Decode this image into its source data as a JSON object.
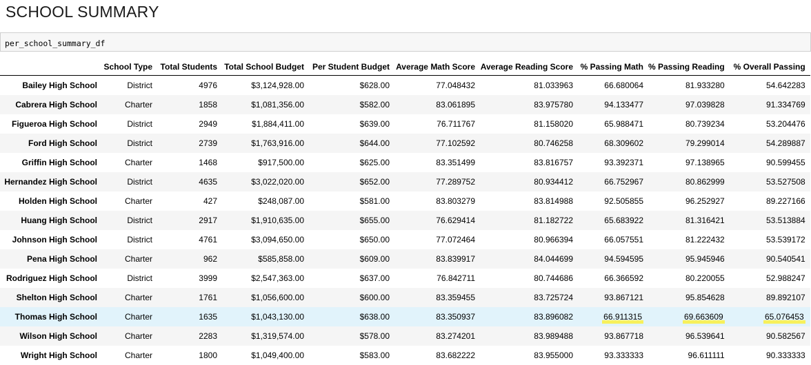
{
  "page": {
    "title": "SCHOOL SUMMARY",
    "code": "per_school_summary_df"
  },
  "table": {
    "columns": [
      "",
      "School Type",
      "Total Students",
      "Total School Budget",
      "Per Student Budget",
      "Average Math Score",
      "Average Reading Score",
      "% Passing Math",
      "% Passing Reading",
      "% Overall Passing"
    ],
    "rows": [
      [
        "Bailey High School",
        "District",
        "4976",
        "$3,124,928.00",
        "$628.00",
        "77.048432",
        "81.033963",
        "66.680064",
        "81.933280",
        "54.642283"
      ],
      [
        "Cabrera High School",
        "Charter",
        "1858",
        "$1,081,356.00",
        "$582.00",
        "83.061895",
        "83.975780",
        "94.133477",
        "97.039828",
        "91.334769"
      ],
      [
        "Figueroa High School",
        "District",
        "2949",
        "$1,884,411.00",
        "$639.00",
        "76.711767",
        "81.158020",
        "65.988471",
        "80.739234",
        "53.204476"
      ],
      [
        "Ford High School",
        "District",
        "2739",
        "$1,763,916.00",
        "$644.00",
        "77.102592",
        "80.746258",
        "68.309602",
        "79.299014",
        "54.289887"
      ],
      [
        "Griffin High School",
        "Charter",
        "1468",
        "$917,500.00",
        "$625.00",
        "83.351499",
        "83.816757",
        "93.392371",
        "97.138965",
        "90.599455"
      ],
      [
        "Hernandez High School",
        "District",
        "4635",
        "$3,022,020.00",
        "$652.00",
        "77.289752",
        "80.934412",
        "66.752967",
        "80.862999",
        "53.527508"
      ],
      [
        "Holden High School",
        "Charter",
        "427",
        "$248,087.00",
        "$581.00",
        "83.803279",
        "83.814988",
        "92.505855",
        "96.252927",
        "89.227166"
      ],
      [
        "Huang High School",
        "District",
        "2917",
        "$1,910,635.00",
        "$655.00",
        "76.629414",
        "81.182722",
        "65.683922",
        "81.316421",
        "53.513884"
      ],
      [
        "Johnson High School",
        "District",
        "4761",
        "$3,094,650.00",
        "$650.00",
        "77.072464",
        "80.966394",
        "66.057551",
        "81.222432",
        "53.539172"
      ],
      [
        "Pena High School",
        "Charter",
        "962",
        "$585,858.00",
        "$609.00",
        "83.839917",
        "84.044699",
        "94.594595",
        "95.945946",
        "90.540541"
      ],
      [
        "Rodriguez High School",
        "District",
        "3999",
        "$2,547,363.00",
        "$637.00",
        "76.842711",
        "80.744686",
        "66.366592",
        "80.220055",
        "52.988247"
      ],
      [
        "Shelton High School",
        "Charter",
        "1761",
        "$1,056,600.00",
        "$600.00",
        "83.359455",
        "83.725724",
        "93.867121",
        "95.854628",
        "89.892107"
      ],
      [
        "Thomas High School",
        "Charter",
        "1635",
        "$1,043,130.00",
        "$638.00",
        "83.350937",
        "83.896082",
        "66.911315",
        "69.663609",
        "65.076453"
      ],
      [
        "Wilson High School",
        "Charter",
        "2283",
        "$1,319,574.00",
        "$578.00",
        "83.274201",
        "83.989488",
        "93.867718",
        "96.539641",
        "90.582567"
      ],
      [
        "Wright High School",
        "Charter",
        "1800",
        "$1,049,400.00",
        "$583.00",
        "83.682222",
        "83.955000",
        "93.333333",
        "96.611111",
        "90.333333"
      ]
    ]
  },
  "highlight": {
    "row_index": 12,
    "highlighted_columns": [
      7,
      8,
      9
    ],
    "row_color": "#e1f3fb",
    "marker_color": "#f7f05c"
  }
}
